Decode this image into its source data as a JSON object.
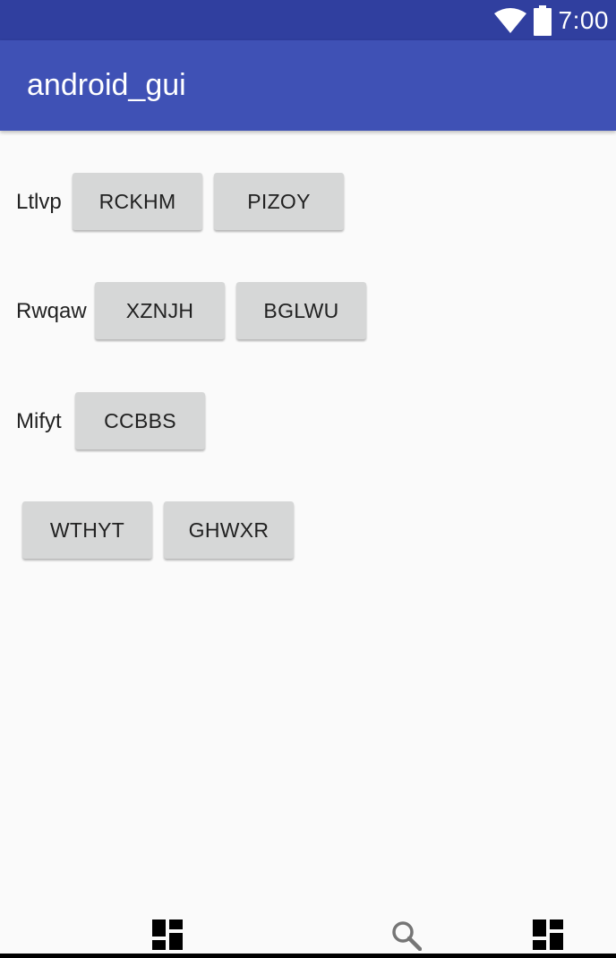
{
  "status_bar": {
    "time": "7:00",
    "icons": [
      "wifi-icon",
      "battery-icon"
    ]
  },
  "app_bar": {
    "title": "android_gui"
  },
  "rows": [
    {
      "label": "Ltlvp",
      "buttons": [
        "RCKHM",
        "PIZOY"
      ]
    },
    {
      "label": "Rwqaw",
      "buttons": [
        "XZNJH",
        "BGLWU"
      ]
    },
    {
      "label": "Mifyt",
      "buttons": [
        "CCBBS"
      ]
    },
    {
      "label": "",
      "buttons": [
        "WTHYT",
        "GHWXR"
      ]
    }
  ],
  "nav_bar": {
    "icons": [
      "dashboard-icon",
      "search-icon",
      "dashboard-icon"
    ]
  },
  "colors": {
    "status_bar": "#303f9f",
    "app_bar": "#3f51b5",
    "background": "#fafafa",
    "button": "#d6d7d7"
  }
}
